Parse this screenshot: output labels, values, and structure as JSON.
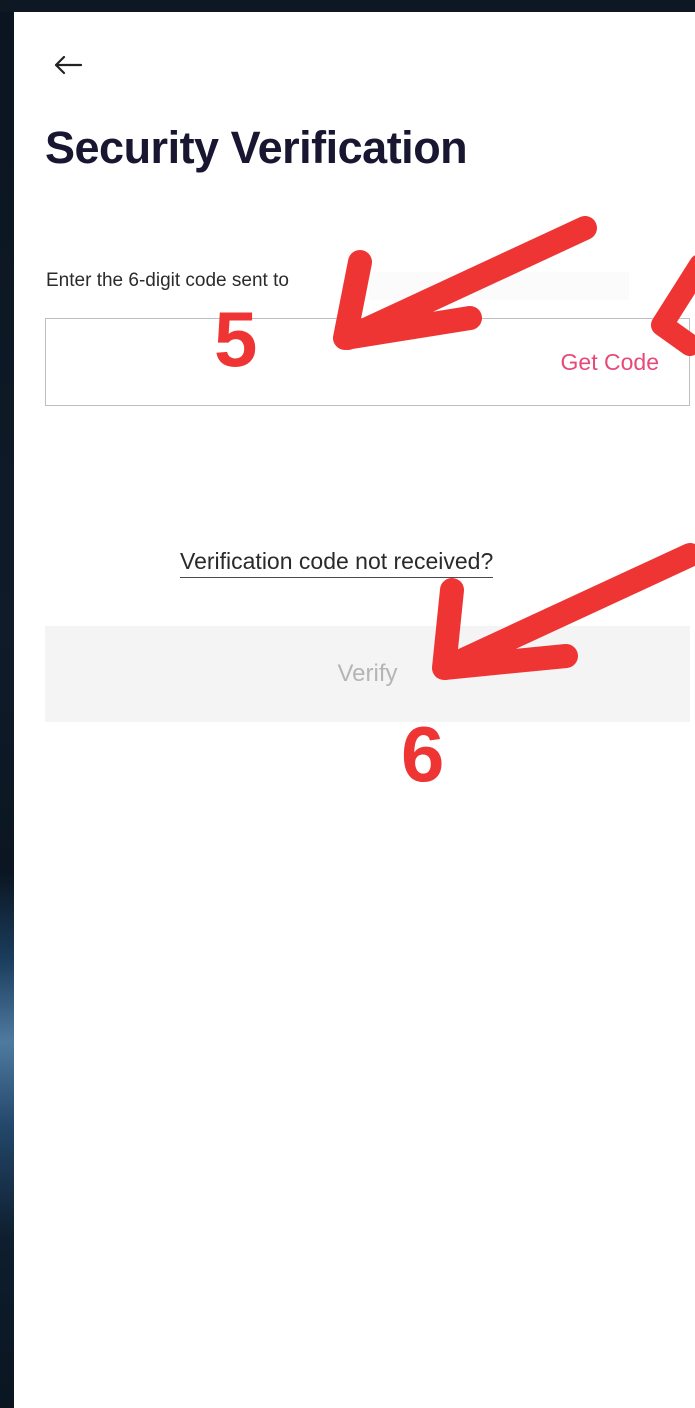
{
  "icons": {
    "back": "arrow-left-icon"
  },
  "page": {
    "title": "Security Verification"
  },
  "verification": {
    "hint": "Enter the 6-digit code sent to",
    "code_value": "",
    "get_code_label": "Get Code",
    "not_received_label": "Verification code not received?",
    "verify_label": "Verify"
  },
  "annotations": {
    "step_a": "5",
    "step_b": "6"
  },
  "colors": {
    "accent": "#e84a78",
    "title": "#181630",
    "button_disabled_bg": "#f4f4f5",
    "button_disabled_text": "#b5b5b8",
    "annotation": "#ef3434"
  }
}
